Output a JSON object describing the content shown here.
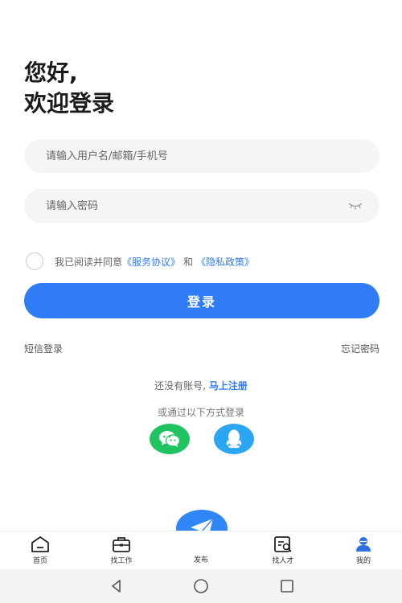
{
  "header": {
    "greeting_line1": "您好,",
    "greeting_line2": "欢迎登录"
  },
  "form": {
    "username_placeholder": "请输入用户名/邮箱/手机号",
    "password_placeholder": "请输入密码"
  },
  "agreement": {
    "prefix": "我已阅读并同意",
    "service_link": "《服务协议》",
    "conjunction": "和",
    "privacy_link": "《隐私政策》"
  },
  "login_button": "登录",
  "sms_login": "短信登录",
  "forgot_password": "忘记密码",
  "register": {
    "prompt": "还没有账号,",
    "link": "马上注册"
  },
  "other_login": "或通过以下方式登录",
  "social": [
    {
      "icon": "wechat-icon",
      "color": "#1fc35f"
    },
    {
      "icon": "qq-icon",
      "color": "#2aa6f3"
    }
  ],
  "tabbar": {
    "home": "首页",
    "jobs": "找工作",
    "publish": "发布",
    "talent": "找人才",
    "mine": "我的"
  },
  "colors": {
    "accent": "#2f7cf6",
    "field_bg": "#f4f5f7"
  }
}
